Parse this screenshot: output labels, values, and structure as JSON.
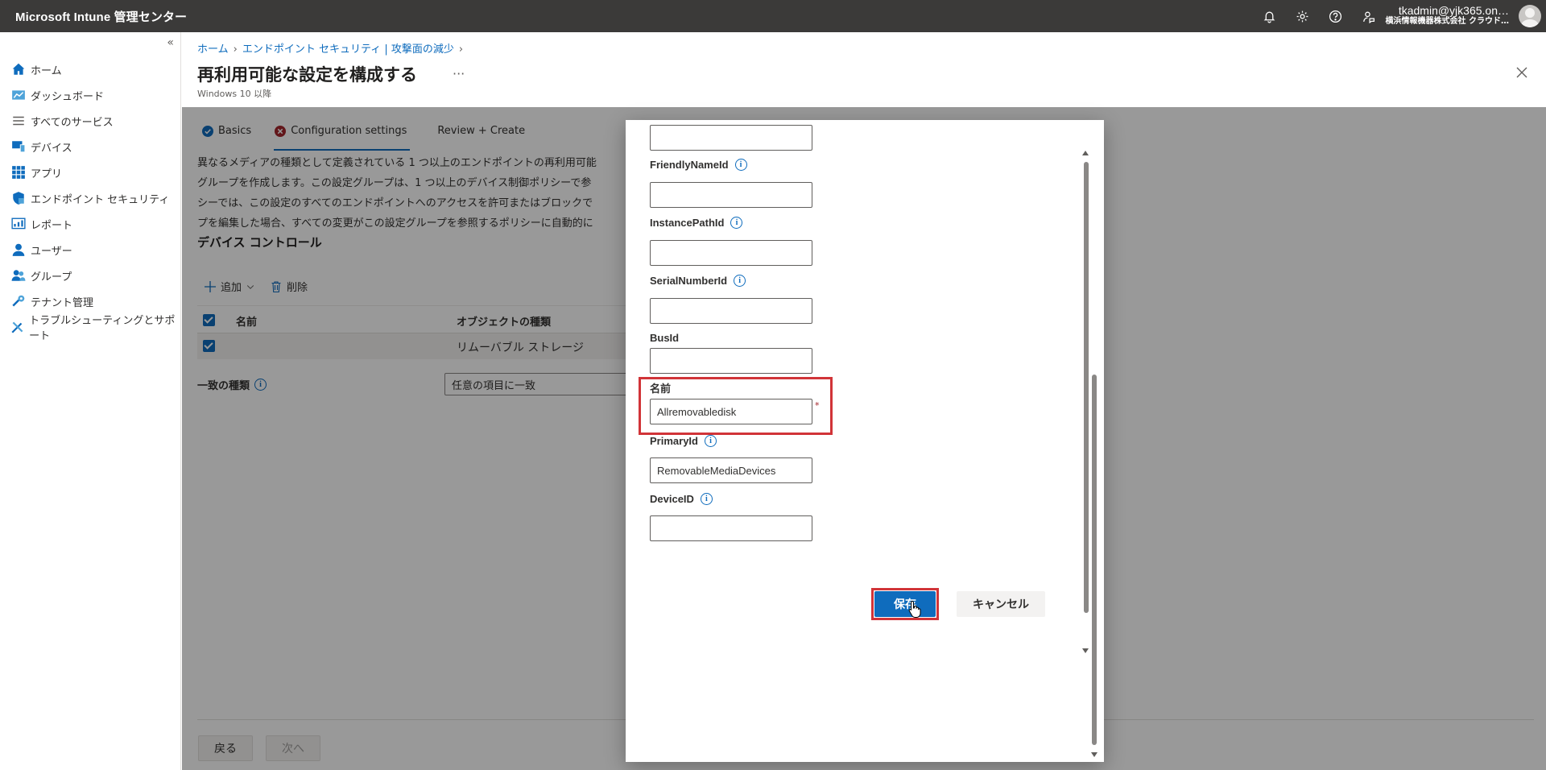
{
  "app": {
    "title": "Microsoft Intune 管理センター",
    "account_name": "tkadmin@yjk365.on…",
    "account_org": "横浜情報機器株式会社 クラウド…",
    "top_icons": [
      "bell-icon",
      "gear-icon",
      "help-icon",
      "feedback-icon"
    ]
  },
  "sidebar": {
    "collapse_glyph": "«",
    "items": [
      {
        "label": "ホーム",
        "icon": "home-icon"
      },
      {
        "label": "ダッシュボード",
        "icon": "dashboard-icon"
      },
      {
        "label": "すべてのサービス",
        "icon": "list-icon"
      },
      {
        "label": "デバイス",
        "icon": "devices-icon"
      },
      {
        "label": "アプリ",
        "icon": "apps-icon"
      },
      {
        "label": "エンドポイント セキュリティ",
        "icon": "shield-icon"
      },
      {
        "label": "レポート",
        "icon": "report-icon"
      },
      {
        "label": "ユーザー",
        "icon": "user-icon"
      },
      {
        "label": "グループ",
        "icon": "group-icon"
      },
      {
        "label": "テナント管理",
        "icon": "tenant-icon"
      },
      {
        "label": "トラブルシューティングとサポート",
        "icon": "wrench-icon"
      }
    ]
  },
  "header": {
    "breadcrumb": [
      "ホーム",
      "エンドポイント セキュリティ | 攻撃面の減少"
    ],
    "title": "再利用可能な設定を構成する",
    "more": "···",
    "subtitle": "Windows 10 以降"
  },
  "wizard": {
    "tabs": [
      {
        "label": "Basics",
        "state": "complete"
      },
      {
        "label": "Configuration settings",
        "state": "error"
      },
      {
        "label": "Review + Create",
        "state": "pending"
      }
    ],
    "description": [
      "異なるメディアの種類として定義されている 1 つ以上のエンドポイントの再利用可能",
      "グループを作成します。この設定グループは、1 つ以上のデバイス制御ポリシーで参",
      "シーでは、この設定のすべてのエンドポイントへのアクセスを許可またはブロックで",
      "プを編集した場合、すべての変更がこの設定グループを参照するポリシーに自動的に"
    ],
    "section_title": "デバイス コントロール",
    "commands": {
      "add": "追加",
      "delete": "削除"
    },
    "table": {
      "headers": [
        "名前",
        "オブジェクトの種類"
      ],
      "rows": [
        {
          "name": "",
          "type": "リムーバブル ストレージ"
        }
      ]
    },
    "match_label": "一致の種類",
    "match_value": "任意の項目に一致",
    "back_label": "戻る",
    "next_label": "次へ"
  },
  "modal": {
    "fields": [
      {
        "label": "",
        "value": ""
      },
      {
        "label": "FriendlyNameId",
        "value": ""
      },
      {
        "label": "InstancePathId",
        "value": ""
      },
      {
        "label": "SerialNumberId",
        "value": ""
      },
      {
        "label": "BusId",
        "value": ""
      },
      {
        "label": "名前",
        "value": "Allremovabledisk",
        "required": "*"
      },
      {
        "label": "PrimaryId",
        "value": "RemovableMediaDevices"
      },
      {
        "label": "DeviceID",
        "value": ""
      }
    ],
    "save_label": "保存",
    "cancel_label": "キャンセル"
  },
  "colors": {
    "accent": "#0f6cbd",
    "highlight": "#d13438",
    "topbar": "#3b3a39"
  }
}
